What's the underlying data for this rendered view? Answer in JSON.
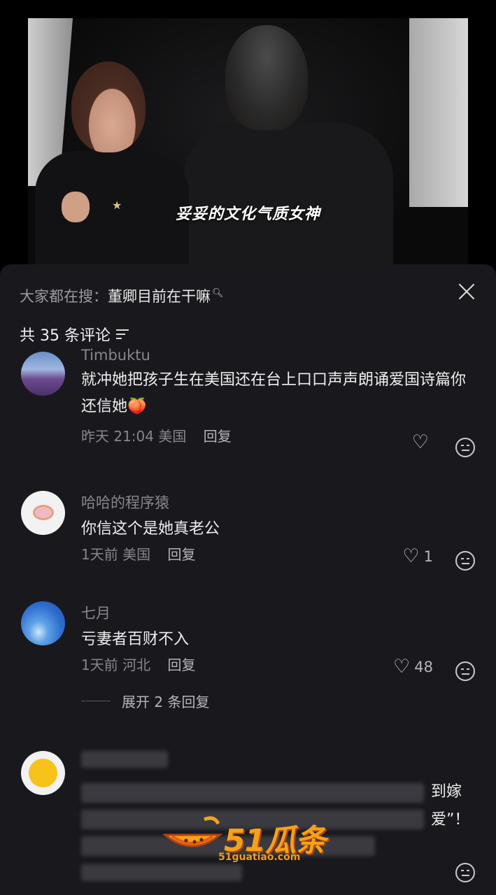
{
  "video": {
    "subtitle": "妥妥的文化气质女神"
  },
  "sheet": {
    "search_prefix": "大家都在搜：",
    "search_keyword": "董卿目前在干嘛",
    "comment_count_label": "共 35 条评论"
  },
  "comments": [
    {
      "name": "Timbuktu",
      "text": "就冲她把孩子生在美国还在台上口口声声朗诵爱国诗篇你还信她",
      "time": "昨天 21:04",
      "location": "美国",
      "reply": "回复",
      "likes": ""
    },
    {
      "name": "哈哈的程序猿",
      "text": "你信这个是她真老公",
      "time": "1天前",
      "location": "美国",
      "reply": "回复",
      "likes": "1"
    },
    {
      "name": "七月",
      "text": "亏妻者百财不入",
      "time": "1天前",
      "location": "河北",
      "reply": "回复",
      "likes": "48",
      "expand": "展开 2 条回复"
    }
  ],
  "partial_comment": {
    "line1_tail": "到嫁",
    "line2_tail": "爱”！"
  },
  "watermark": {
    "logo": "51瓜条",
    "url": "51guatiao.com"
  }
}
